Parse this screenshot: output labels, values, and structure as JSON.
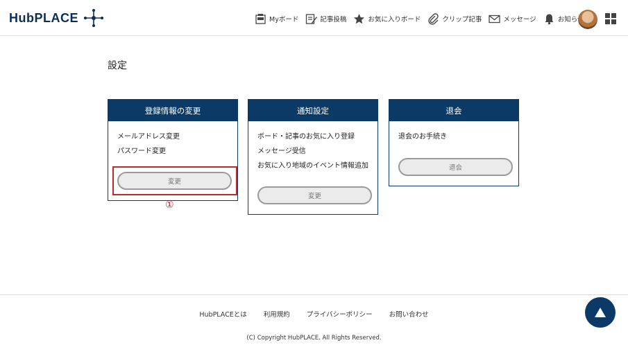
{
  "header": {
    "logo_text": "HubPLACE",
    "nav": [
      {
        "label": "Myボード",
        "icon": "my-board-icon"
      },
      {
        "label": "記事投稿",
        "icon": "post-article-icon"
      },
      {
        "label": "お気に入りボード",
        "icon": "star-icon"
      },
      {
        "label": "クリップ記事",
        "icon": "paperclip-icon"
      },
      {
        "label": "メッセージ",
        "icon": "envelope-icon"
      },
      {
        "label": "お知らせ",
        "icon": "bell-icon"
      }
    ]
  },
  "page": {
    "title": "設定"
  },
  "cards": [
    {
      "title": "登録情報の変更",
      "items": [
        "メールアドレス変更",
        "パスワード変更"
      ],
      "button": "変更"
    },
    {
      "title": "通知設定",
      "items": [
        "ボード・記事のお気に入り登録",
        "メッセージ受信",
        "お気に入り地域のイベント情報追加"
      ],
      "button": "変更"
    },
    {
      "title": "退会",
      "items": [
        "退会のお手続き"
      ],
      "button": "退会"
    }
  ],
  "annotation": {
    "marker": "①",
    "color": "#c62828"
  },
  "footer": {
    "links": [
      "HubPLACEとは",
      "利用規約",
      "プライバシーポリシー",
      "お問い合わせ"
    ],
    "copyright": "(C) Copyright HubPLACE. All Rights Reserved."
  },
  "colors": {
    "brand": "#0b3a66",
    "highlight": "#c62828"
  }
}
